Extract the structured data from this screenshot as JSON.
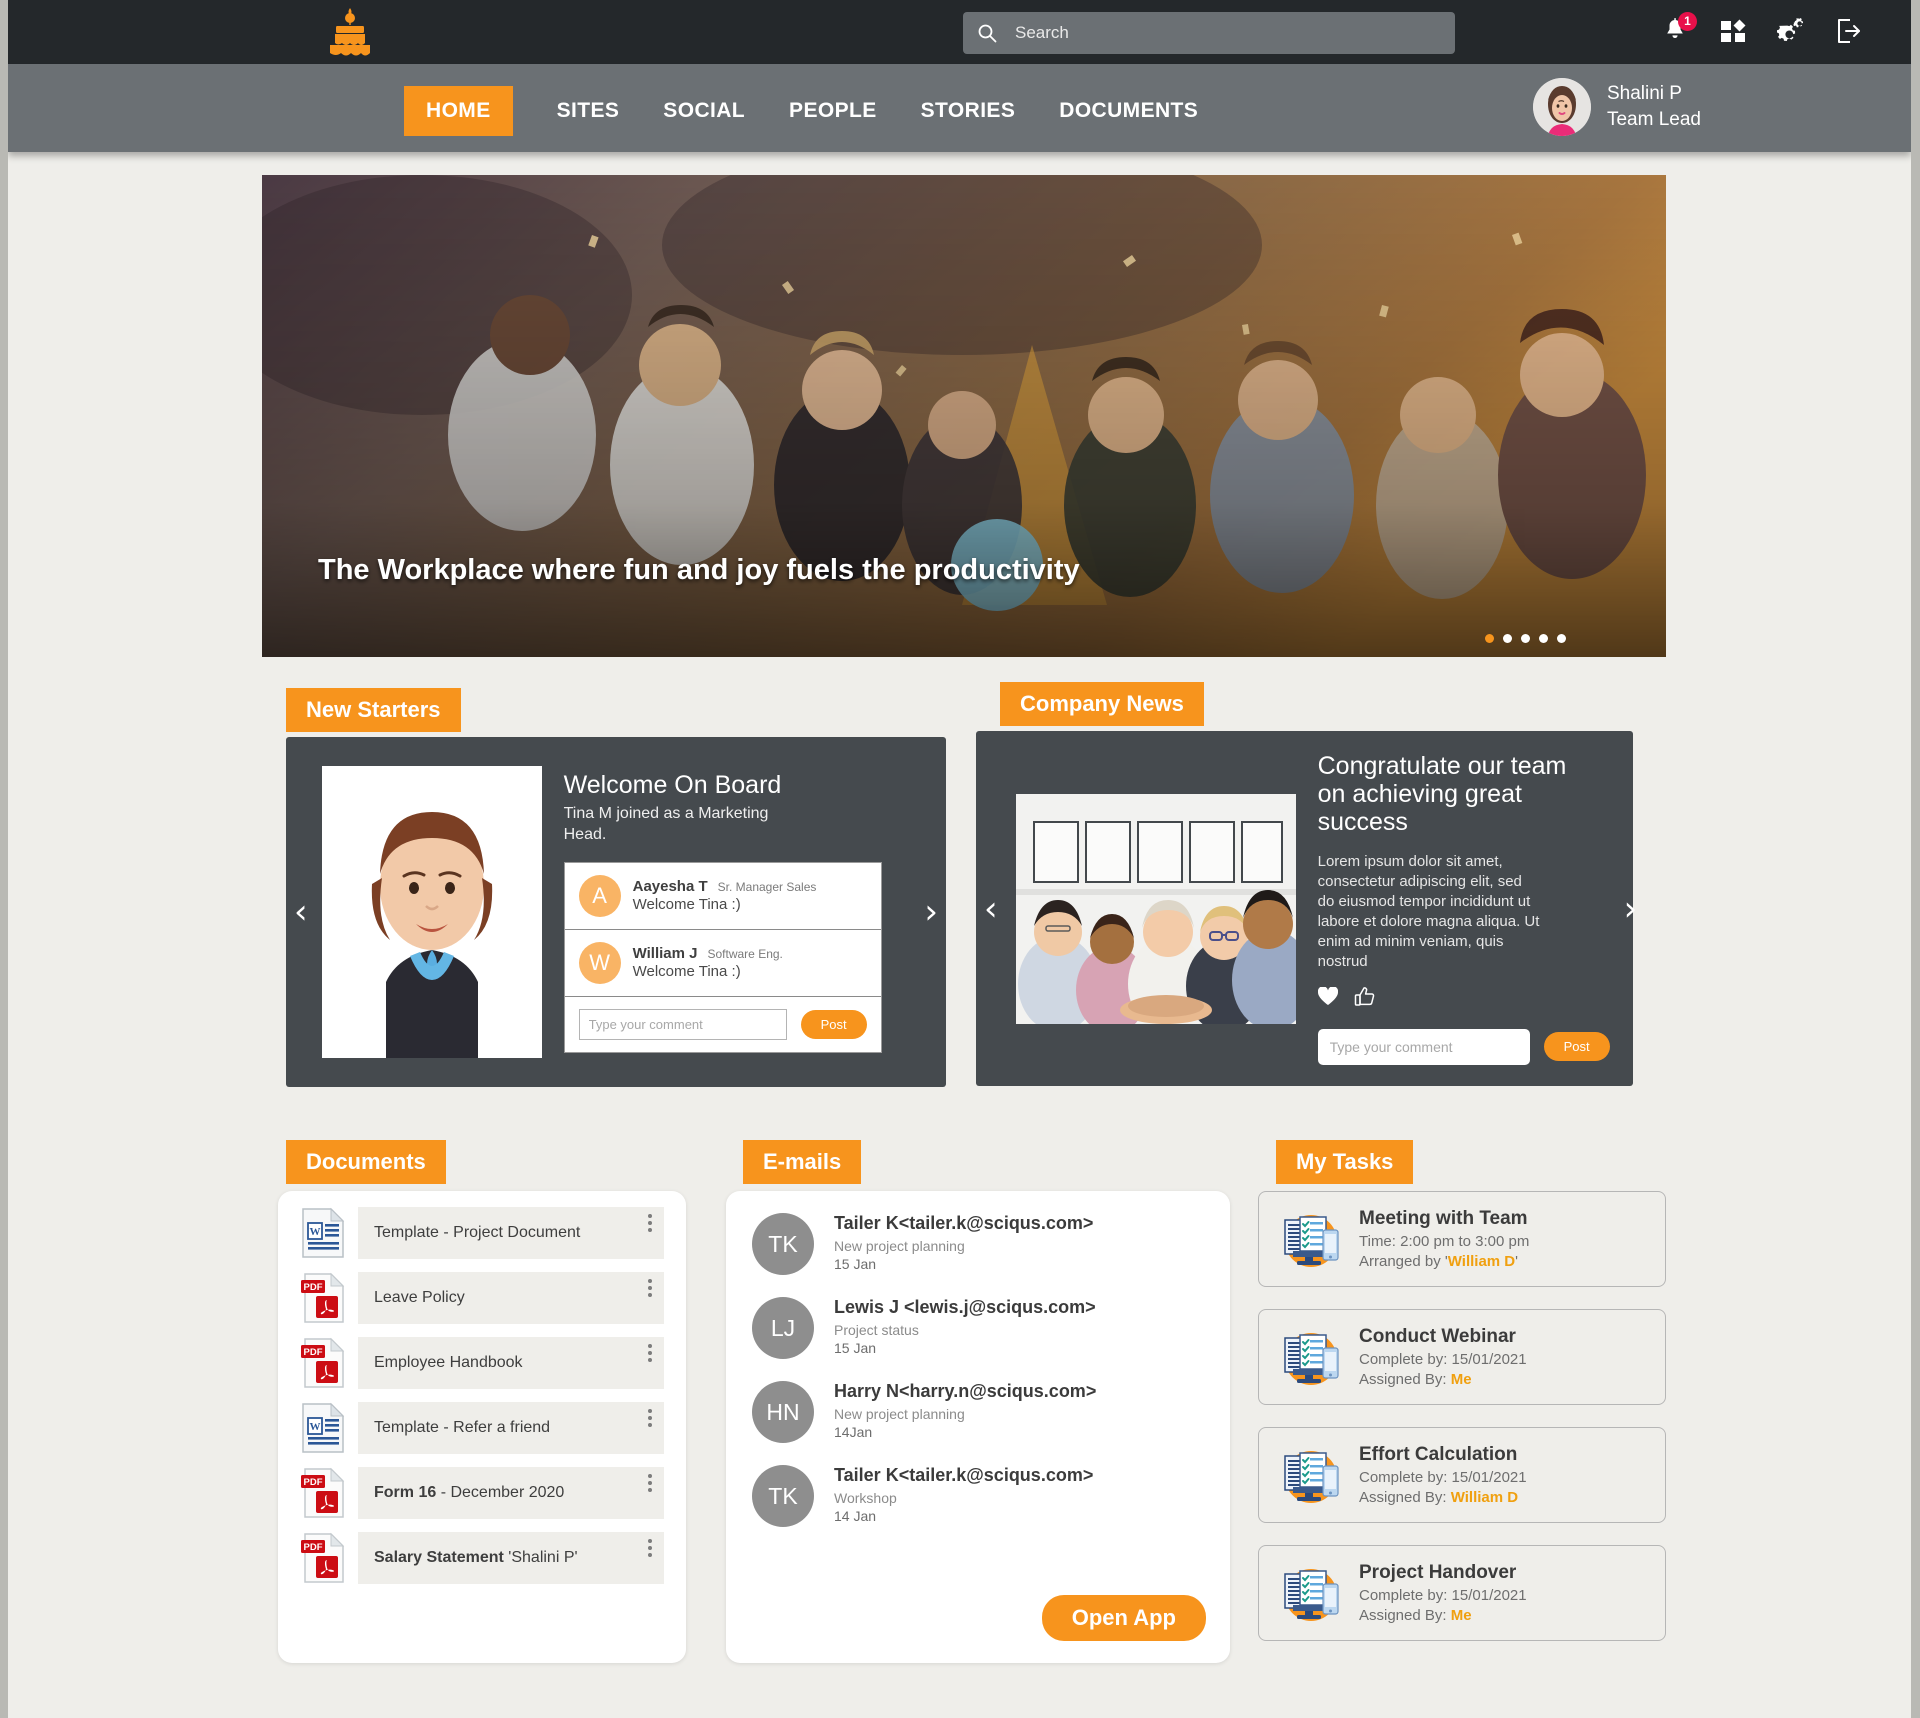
{
  "brand": {
    "logo_icon": "cake-logo-icon",
    "accent": "#f7941d"
  },
  "topbar": {
    "search": {
      "placeholder": "Search",
      "value": "",
      "icon": "search-icon"
    },
    "icons": [
      {
        "name": "notifications-bell-icon",
        "badge": "1"
      },
      {
        "name": "apps-grid-icon",
        "badge": ""
      },
      {
        "name": "settings-gears-icon",
        "badge": ""
      },
      {
        "name": "logout-icon",
        "badge": ""
      }
    ]
  },
  "nav": {
    "items": [
      {
        "label": "HOME",
        "active": true
      },
      {
        "label": "SITES",
        "active": false
      },
      {
        "label": "SOCIAL",
        "active": false
      },
      {
        "label": "PEOPLE",
        "active": false
      },
      {
        "label": "STORIES",
        "active": false
      },
      {
        "label": "DOCUMENTS",
        "active": false
      }
    ],
    "profile": {
      "name": "Shalini P",
      "role": "Team Lead",
      "avatar": "user-avatar"
    }
  },
  "hero": {
    "caption": "The Workplace where fun and joy fuels the productivity",
    "dots_count": 5,
    "active_dot": 0,
    "prev_label": "‹",
    "next_label": "›"
  },
  "new_starters": {
    "header": "New Starters",
    "title": "Welcome On Board",
    "subtitle": "Tina M joined as a Marketing Head.",
    "prev_label": "‹",
    "next_label": "›",
    "comments": [
      {
        "initial": "A",
        "name": "Aayesha T",
        "role": "Sr. Manager Sales",
        "message": "Welcome Tina :)"
      },
      {
        "initial": "W",
        "name": "William J",
        "role": "Software Eng.",
        "message": "Welcome Tina :)"
      }
    ],
    "comment_placeholder": "Type your comment",
    "post_label": "Post"
  },
  "company_news": {
    "header": "Company News",
    "title_line1": "Congratulate our team",
    "title_line2": "on achieving great success",
    "body": "Lorem ipsum dolor sit amet, consectetur adipiscing elit, sed do eiusmod tempor incididunt ut labore et dolore magna aliqua. Ut enim ad minim veniam, quis nostrud",
    "prev_label": "‹",
    "next_label": "›",
    "reactions": [
      {
        "name": "heart-icon"
      },
      {
        "name": "thumbs-up-icon"
      }
    ],
    "comment_placeholder": "Type your comment",
    "post_label": "Post"
  },
  "documents": {
    "header": "Documents",
    "items": [
      {
        "type": "word",
        "name": "Template - Project Document",
        "bold": "",
        "menu_icon": "kebab-menu-icon"
      },
      {
        "type": "pdf",
        "name": "Leave Policy",
        "bold": "",
        "menu_icon": "kebab-menu-icon"
      },
      {
        "type": "pdf",
        "name": "Employee Handbook",
        "bold": "",
        "menu_icon": "kebab-menu-icon"
      },
      {
        "type": "word",
        "name": "Template -  Refer a friend",
        "bold": "",
        "menu_icon": "kebab-menu-icon"
      },
      {
        "type": "pdf",
        "name": " - December 2020",
        "bold": "Form 16",
        "menu_icon": "kebab-menu-icon"
      },
      {
        "type": "pdf",
        "name": " 'Shalini P'",
        "bold": "Salary Statement",
        "menu_icon": "kebab-menu-icon"
      }
    ]
  },
  "emails": {
    "header": "E-mails",
    "items": [
      {
        "initials": "TK",
        "from": "Tailer K<tailer.k@sciqus.com>",
        "subject": "New project planning",
        "date": "15 Jan"
      },
      {
        "initials": "LJ",
        "from": "Lewis J <lewis.j@sciqus.com>",
        "subject": "Project status",
        "date": "15 Jan"
      },
      {
        "initials": "HN",
        "from": "Harry N<harry.n@sciqus.com>",
        "subject": "New project planning",
        "date": "14Jan"
      },
      {
        "initials": "TK",
        "from": "Tailer K<tailer.k@sciqus.com>",
        "subject": "Workshop",
        "date": "14 Jan"
      }
    ],
    "open_app_label": "Open App"
  },
  "tasks": {
    "header": "My Tasks",
    "items": [
      {
        "title": "Meeting with Team",
        "line1": "Time: 2:00 pm to 3:00 pm",
        "line2_prefix": "Arranged by '",
        "line2_hl": "William D",
        "line2_suffix": "'",
        "icon": "task-checklist-icon"
      },
      {
        "title": "Conduct Webinar",
        "line1": "Complete by: 15/01/2021",
        "line2_prefix": "Assigned By: ",
        "line2_hl": "Me",
        "line2_suffix": "",
        "icon": "task-checklist-icon"
      },
      {
        "title": "Effort Calculation",
        "line1": "Complete by: 15/01/2021",
        "line2_prefix": "Assigned By: ",
        "line2_hl": "William D",
        "line2_suffix": "",
        "icon": "task-checklist-icon"
      },
      {
        "title": "Project Handover",
        "line1": "Complete by: 15/01/2021",
        "line2_prefix": "Assigned By: ",
        "line2_hl": "Me",
        "line2_suffix": "",
        "icon": "task-checklist-icon"
      }
    ]
  }
}
